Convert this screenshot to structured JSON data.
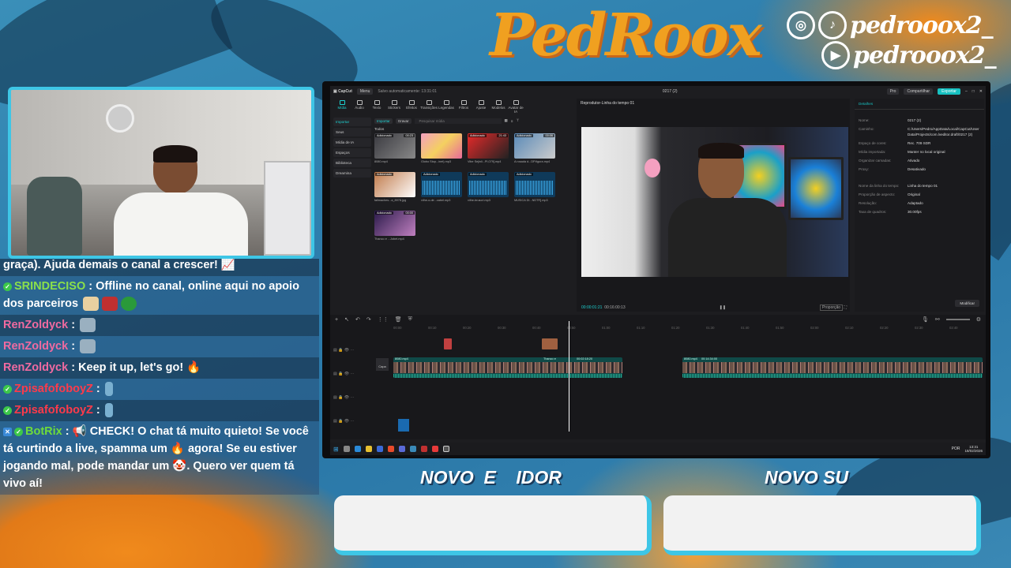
{
  "brand": {
    "title": "PedRoox"
  },
  "social": {
    "instagram_icon": "instagram-icon",
    "tiktok_icon": "tiktok-icon",
    "youtube_icon": "youtube-icon",
    "handle": "pedrooox2_"
  },
  "chat": {
    "top_fragment": "graça). Ajuda demais o canal a crescer! 📈",
    "messages": [
      {
        "user": "SRINDECISO",
        "text": "Offline no canal, online aqui no apoio dos parceiros"
      },
      {
        "user": "RenZoldyck",
        "text": ""
      },
      {
        "user": "RenZoldyck",
        "text": ""
      },
      {
        "user": "RenZoldyck",
        "text": "Keep it up, let's go! 🔥"
      },
      {
        "user": "ZpisafofoboyZ",
        "text": ""
      },
      {
        "user": "ZpisafofoboyZ",
        "text": ""
      },
      {
        "user": "BotRix",
        "text": "📢 CHECK! O chat tá muito quieto! Se você tá curtindo a live, spamma um 🔥 agora! Se eu estiver jogando mal, pode mandar um 🤡. Quero ver quem tá vivo aí!"
      }
    ]
  },
  "app": {
    "title": "0217 (2)",
    "menu": "Menu",
    "autosave": "Salvo automaticamente: 13:31:01",
    "pro": "Pro",
    "share": "Compartilhar",
    "export": "Exportar",
    "tools": [
      "Mídia",
      "Áudio",
      "Texto",
      "Stickers",
      "Efeitos",
      "Transições",
      "Legendas",
      "Filtros",
      "Ajuste",
      "Modelos",
      "Avatar de IA"
    ],
    "leftnav": [
      "Importar",
      "Seus",
      "Mídia de IA",
      "Espaços",
      "Biblioteca",
      "Dreamina"
    ],
    "media_import": "Importar",
    "media_record": "Gravar",
    "media_search": "Pesquisar mídia",
    "media_all": "Todos",
    "media_items": [
      {
        "tag": "Adicionado",
        "tag2": "00:23",
        "cap": "8080.mp4"
      },
      {
        "tag": "",
        "tag2": "",
        "cap": "Globo Stop...inet).mp3"
      },
      {
        "tag": "Adicionado",
        "tag2": "21:43",
        "cap": "Vibe Sejinli...PI,079].mp4"
      },
      {
        "tag": "Adicionado",
        "tag2": "00:06",
        "cap": "A rosada d...DP.figura.mp4"
      },
      {
        "tag": "Adicionado",
        "tag2": "",
        "cap": "fallmaches...a_8978.jpg"
      },
      {
        "tag": "Adicionado",
        "tag2": "",
        "cap": "vilhe-o-de...cabel.mp3"
      },
      {
        "tag": "Adicionado",
        "tag2": "",
        "cap": "vilhe-bruscri.mp3"
      },
      {
        "tag": "Adicionado",
        "tag2": "",
        "cap": "MUSICA DI...NDTR].mp3"
      },
      {
        "tag": "Adicionado",
        "tag2": "00:00",
        "cap": "Thanco e ...Jobet.mp4"
      }
    ],
    "player_title": "Reprodutor-Linha do tempo 01",
    "player_time": "00:00:01:21",
    "player_total": "00:16:00:13",
    "player_ratio": "Proporção",
    "details_title": "Detalhes",
    "details": [
      {
        "k": "Nome:",
        "v": "0217 (2)"
      },
      {
        "k": "Caminho:",
        "v": "C:/Users/Pedro/AppData/Local/CapCut/User Data/Projects/com.lveditor.draft/0217 (2)"
      },
      {
        "k": "Espaço de cores:",
        "v": "Rec. 709 SDR"
      },
      {
        "k": "Mídia importada:",
        "v": "Manter no local original"
      },
      {
        "k": "Organizar camadas:",
        "v": "Ativado"
      },
      {
        "k": "Proxy:",
        "v": "Desativado"
      },
      {
        "k": "Nome da linha do tempo:",
        "v": "Linha do tempo 01"
      },
      {
        "k": "Proporção de aspecto:",
        "v": "Original"
      },
      {
        "k": "Resolução:",
        "v": "Adaptado"
      },
      {
        "k": "Taxa de quadros:",
        "v": "30.00fps"
      }
    ],
    "modify": "Modificar",
    "ruler": [
      "00:00",
      "00:10",
      "00:20",
      "00:30",
      "00:40",
      "00:50",
      "01:00",
      "01:10",
      "01:20",
      "01:30",
      "01:40",
      "01:50",
      "02:00",
      "02:10",
      "02:20",
      "02:30",
      "02:40"
    ],
    "clip_labels": [
      "8080.mp4",
      "00:00:03:18",
      "Thanco e",
      "8080.mp4",
      "00:02:18:20",
      "8080.mp4",
      "00:14:34:00"
    ],
    "cover": "Capa",
    "taskbar_time": "13:31",
    "taskbar_date": "18/02/2026",
    "taskbar_lang": "POR"
  },
  "banners": {
    "left": "NOVO  E    IDOR",
    "right": "NOVO SU"
  },
  "colors": {
    "accent": "#3ec6e6",
    "brand": "#f0a020",
    "export": "#17c1c1"
  }
}
